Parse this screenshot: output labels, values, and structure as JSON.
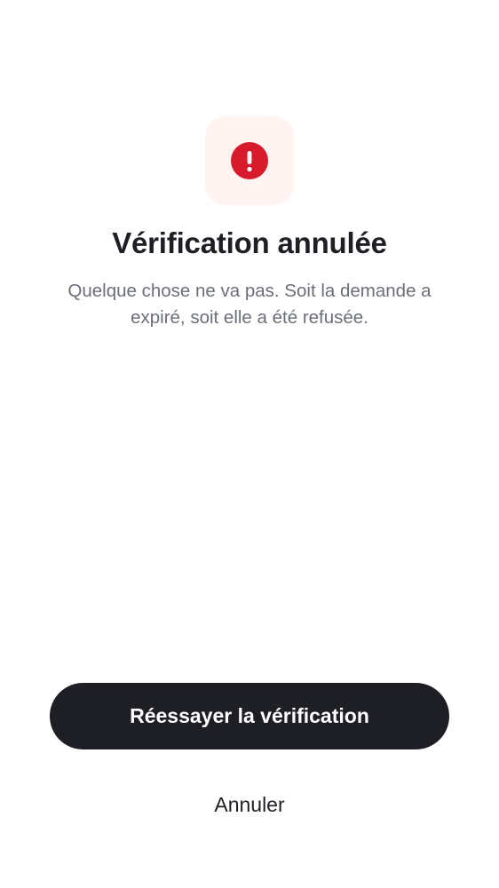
{
  "status": {
    "icon": "alert-circle-icon",
    "icon_color": "#d81b2c",
    "tile_color": "#fff4f2"
  },
  "title": "Vérification annulée",
  "message": "Quelque chose ne va pas. Soit la demande a expiré, soit elle a été refusée.",
  "actions": {
    "retry_label": "Réessayer la vérification",
    "cancel_label": "Annuler"
  },
  "colors": {
    "primary_button": "#1e1f24",
    "text_primary": "#1e1f24",
    "text_secondary": "#6b6f78"
  }
}
